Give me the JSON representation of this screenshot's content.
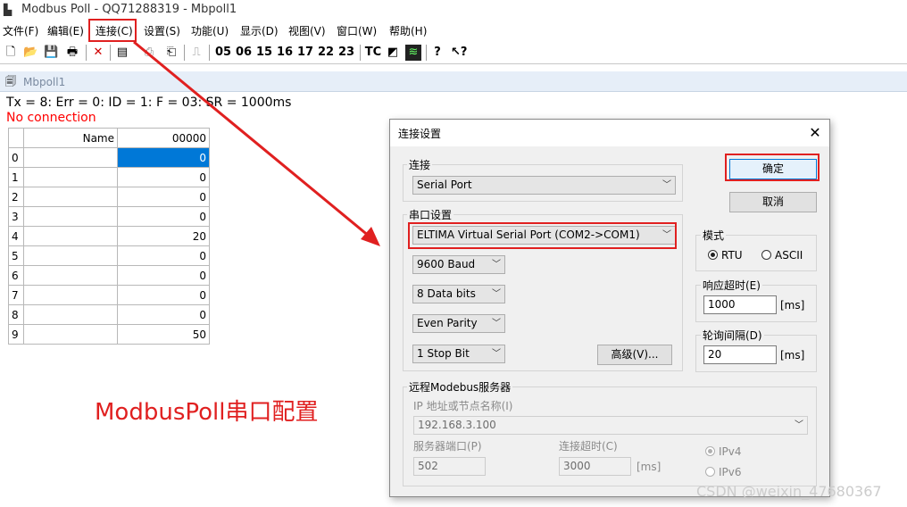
{
  "window": {
    "title": "Modbus Poll - QQ71288319 - Mbpoll1",
    "app_icon": "modbus-app-icon"
  },
  "menu": [
    "文件(F)",
    "编辑(E)",
    "连接(C)",
    "设置(S)",
    "功能(U)",
    "显示(D)",
    "视图(V)",
    "窗口(W)",
    "帮助(H)"
  ],
  "toolbar": {
    "function_codes": [
      "05",
      "06",
      "15",
      "16",
      "17",
      "22",
      "23"
    ],
    "tc_label": "TC",
    "icons": [
      "new-icon",
      "open-icon",
      "save-icon",
      "print-icon",
      "disconnect-icon",
      "window-icon",
      "read-icon",
      "print-preview-icon",
      "pulse-icon",
      "help-icon",
      "context-help-icon"
    ]
  },
  "child": {
    "title": "Mbpoll1",
    "status": "Tx = 8: Err = 0: ID = 1: F = 03: SR = 1000ms",
    "connection": "No connection",
    "grid": {
      "headers": [
        "Name",
        "00000"
      ],
      "rows": [
        {
          "idx": "0",
          "value": "0"
        },
        {
          "idx": "1",
          "value": "0"
        },
        {
          "idx": "2",
          "value": "0"
        },
        {
          "idx": "3",
          "value": "0"
        },
        {
          "idx": "4",
          "value": "20"
        },
        {
          "idx": "5",
          "value": "0"
        },
        {
          "idx": "6",
          "value": "0"
        },
        {
          "idx": "7",
          "value": "0"
        },
        {
          "idx": "8",
          "value": "0"
        },
        {
          "idx": "9",
          "value": "50"
        }
      ]
    }
  },
  "overlay_label": "ModbusPoll串口配置",
  "dialog": {
    "title": "连接设置",
    "close": "✕",
    "connection_group": "连接",
    "connection_value": "Serial Port",
    "serial_group": "串口设置",
    "port_value": "ELTIMA Virtual Serial Port (COM2->COM1)",
    "baud_value": "9600 Baud",
    "databits_value": "8 Data bits",
    "parity_value": "Even Parity",
    "stopbit_value": "1 Stop Bit",
    "advanced_label": "高级(V)...",
    "ok_label": "确定",
    "cancel_label": "取消",
    "mode_group": "模式",
    "mode_rtu": "RTU",
    "mode_ascii": "ASCII",
    "timeout_group": "响应超时(E)",
    "timeout_value": "1000",
    "timeout_unit": "[ms]",
    "poll_group": "轮询间隔(D)",
    "poll_value": "20",
    "poll_unit": "[ms]",
    "remote_group": "远程Modebus服务器",
    "ip_label": "IP 地址或节点名称(I)",
    "ip_value": "192.168.3.100",
    "port_label": "服务器端口(P)",
    "port_num": "502",
    "conn_timeout_label": "连接超时(C)",
    "conn_timeout_value": "3000",
    "conn_timeout_unit": "[ms]",
    "ipv4": "IPv4",
    "ipv6": "IPv6"
  },
  "watermark": "CSDN @weixin_47680367",
  "colors": {
    "highlight": "#e02020",
    "selection": "#0078d7",
    "error": "#ff0000"
  }
}
